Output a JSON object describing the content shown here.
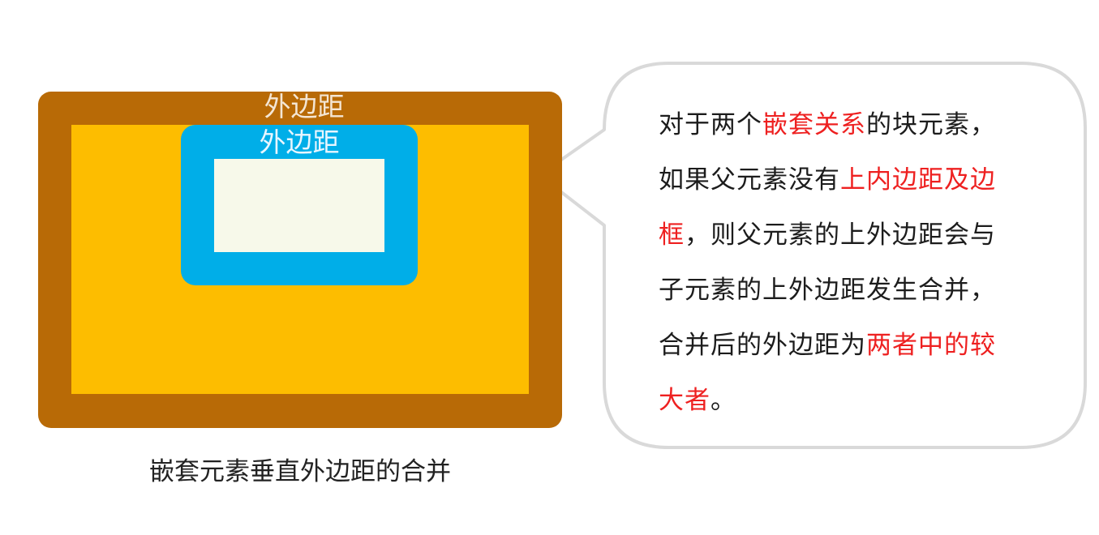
{
  "diagram": {
    "outer_margin_label": "外边距",
    "inner_margin_label": "外边距",
    "caption": "嵌套元素垂直外边距的合并",
    "colors": {
      "parent_margin": "#b86a06",
      "parent_content": "#fdbd00",
      "child_margin": "#00aee8",
      "child_content": "#f7f9ea",
      "highlight_text": "#ee2020"
    }
  },
  "callout": {
    "lines": [
      [
        {
          "text": "对于两个",
          "highlight": false
        },
        {
          "text": "嵌套关系",
          "highlight": true
        },
        {
          "text": "的块元素，",
          "highlight": false
        }
      ],
      [
        {
          "text": "如果父元素没有",
          "highlight": false
        },
        {
          "text": "上内边距及边",
          "highlight": true
        }
      ],
      [
        {
          "text": "框",
          "highlight": true
        },
        {
          "text": "，则父元素的上外边距会与",
          "highlight": false
        }
      ],
      [
        {
          "text": "子元素的上外边距发生合并，",
          "highlight": false
        }
      ],
      [
        {
          "text": "合并后的外边距为",
          "highlight": false
        },
        {
          "text": "两者中的较",
          "highlight": true
        }
      ],
      [
        {
          "text": "大者",
          "highlight": true
        },
        {
          "text": "。",
          "highlight": false
        }
      ]
    ]
  }
}
